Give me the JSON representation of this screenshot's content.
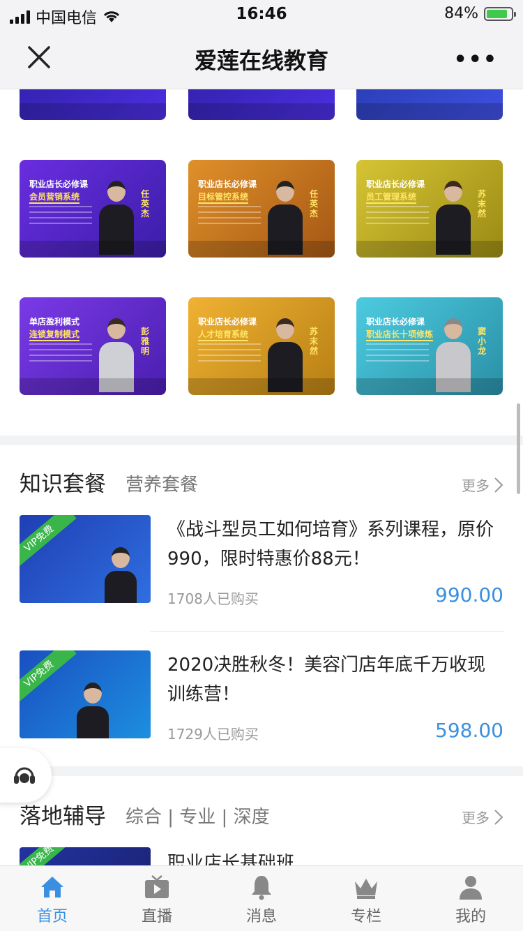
{
  "status_bar": {
    "carrier": "中国电信",
    "time": "16:46",
    "battery": "84%"
  },
  "header": {
    "title": "爱莲在线教育"
  },
  "course_cards": [
    {
      "line1": "职业店长必修课",
      "line2": "会员营销系统",
      "teacher": "任英杰",
      "bg": "#5a28d6"
    },
    {
      "line1": "职业店长必修课",
      "line2": "目标管控系统",
      "teacher": "任英杰",
      "bg": "#c2751e"
    },
    {
      "line1": "职业店长必修课",
      "line2": "员工管理系统",
      "teacher": "苏末然",
      "bg": "#b8a41c"
    },
    {
      "line1": "单店盈利模式",
      "line2": "连锁复制模式",
      "teacher": "彭雅明",
      "bg": "#6a2fd3"
    },
    {
      "line1": "职业店长必修课",
      "line2": "人才培育系统",
      "teacher": "苏末然",
      "bg": "#d9a025"
    },
    {
      "line1": "职业店长必修课",
      "line2": "职业店长十项修炼",
      "teacher": "窦小龙",
      "bg": "#36b3c9"
    }
  ],
  "knowledge": {
    "title": "知识套餐",
    "subtitle": "营养套餐",
    "more": "更多",
    "items": [
      {
        "badge": "VIP免费",
        "title": "《战斗型员工如何培育》系列课程，原价990，限时特惠价88元！",
        "sold": "1708人已购买",
        "price": "990.00"
      },
      {
        "badge": "VIP免费",
        "title": "2020决胜秋冬！美容门店年底千万收现训练营！",
        "sold": "1729人已购买",
        "price": "598.00"
      }
    ]
  },
  "coaching": {
    "title": "落地辅导",
    "subtitle": "综合 | 专业 | 深度",
    "more": "更多",
    "first_item": {
      "badge": "VIP免费",
      "title": "职业店长基础班"
    }
  },
  "tabs": [
    {
      "label": "首页",
      "icon": "home-icon",
      "active": true
    },
    {
      "label": "直播",
      "icon": "tv-icon",
      "active": false
    },
    {
      "label": "消息",
      "icon": "bell-icon",
      "active": false
    },
    {
      "label": "专栏",
      "icon": "crown-icon",
      "active": false
    },
    {
      "label": "我的",
      "icon": "person-icon",
      "active": false
    }
  ],
  "colors": {
    "accent": "#3b8fe0",
    "badge_green": "#39b54a"
  }
}
